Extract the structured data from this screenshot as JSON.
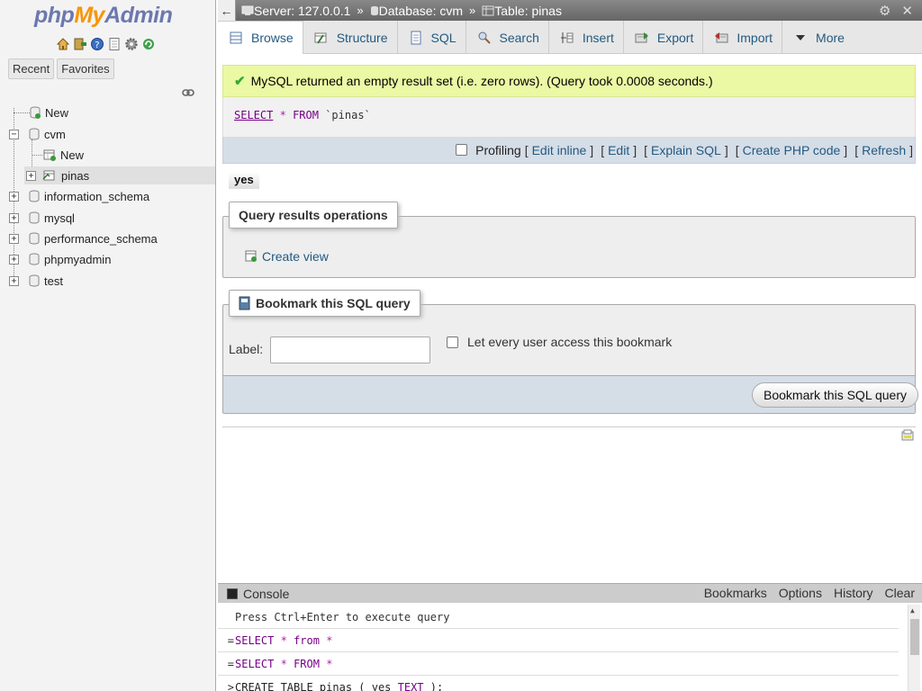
{
  "sidebar": {
    "logo": {
      "php": "php",
      "my": "My",
      "admin": "Admin"
    },
    "recent_tab": "Recent",
    "favorites_tab": "Favorites",
    "tree": [
      {
        "label": "New"
      },
      {
        "label": "cvm",
        "expander": "−"
      },
      {
        "label": "New"
      },
      {
        "label": "pinas",
        "expander": "+"
      },
      {
        "label": "information_schema",
        "expander": "+"
      },
      {
        "label": "mysql",
        "expander": "+"
      },
      {
        "label": "performance_schema",
        "expander": "+"
      },
      {
        "label": "phpmyadmin",
        "expander": "+"
      },
      {
        "label": "test",
        "expander": "+"
      }
    ]
  },
  "breadcrumb": {
    "server": "Server: 127.0.0.1",
    "database": "Database: cvm",
    "table": "Table: pinas",
    "separator": "»"
  },
  "tabs": [
    {
      "label": "Browse",
      "icon": "browse-icon"
    },
    {
      "label": "Structure",
      "icon": "structure-icon"
    },
    {
      "label": "SQL",
      "icon": "sql-icon"
    },
    {
      "label": "Search",
      "icon": "search-icon"
    },
    {
      "label": "Insert",
      "icon": "insert-icon"
    },
    {
      "label": "Export",
      "icon": "export-icon"
    },
    {
      "label": "Import",
      "icon": "import-icon"
    },
    {
      "label": "More",
      "icon": "chevron-down-icon"
    }
  ],
  "message": {
    "text": "MySQL returned an empty result set (i.e. zero rows). (Query took 0.0008 seconds.)"
  },
  "query": {
    "select": "SELECT",
    "star": "*",
    "from": "FROM",
    "table": "`pinas`"
  },
  "query_links": {
    "profiling": "Profiling",
    "edit_inline": "Edit inline",
    "edit": "Edit",
    "explain": "Explain SQL",
    "create_php": "Create PHP code",
    "refresh": "Refresh"
  },
  "result_column": "yes",
  "operations": {
    "legend": "Query results operations",
    "create_view": "Create view"
  },
  "bookmark": {
    "legend": "Bookmark this SQL query",
    "label_text": "Label:",
    "label_value": "",
    "share_label": "Let every user access this bookmark",
    "button": "Bookmark this SQL query"
  },
  "console": {
    "title": "Console",
    "links": [
      "Bookmarks",
      "Options",
      "History",
      "Clear"
    ],
    "hint": "Press Ctrl+Enter to execute query",
    "lines": [
      {
        "marker": "=",
        "kw1": "SELECT",
        "op": "*",
        "kw2": "from",
        "rest": "*"
      },
      {
        "marker": "=",
        "kw1": "SELECT",
        "op": "*",
        "kw2": "FROM",
        "rest": "*"
      },
      {
        "marker": ">",
        "text": "CREATE TABLE pinas ( yes ",
        "kw": "TEXT",
        "tail": " );"
      }
    ]
  },
  "colors": {
    "link": "#235a81",
    "success_bg": "#ebf8a4",
    "sql_keyword": "#770088",
    "footer_bg": "#d5dde7"
  }
}
